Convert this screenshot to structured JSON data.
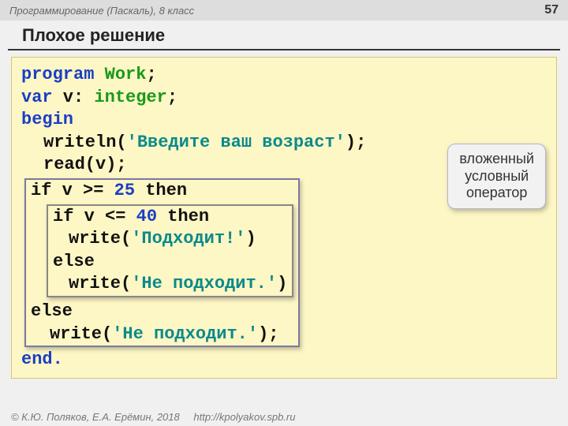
{
  "header": {
    "course": "Программирование (Паскаль), 8 класс",
    "page": "57"
  },
  "title": "Плохое решение",
  "code": {
    "kw_program": "program",
    "prog_name": "Work",
    "semi": ";",
    "kw_var": "var",
    "var_decl": " v: ",
    "kw_integer": "integer",
    "kw_begin": "begin",
    "writeln": "writeln(",
    "str1": "'Введите ваш возраст'",
    "close_paren_semi": ");",
    "read": "read(v);",
    "if1_a": "if v >= ",
    "num25": "25",
    "if1_b": " then",
    "if2_a": "if v <= ",
    "num40": "40",
    "if2_b": " then",
    "write_ok_a": "write(",
    "str_ok": "'Подходит!'",
    "write_ok_b": ")",
    "else1": "else",
    "write_no_a": "write(",
    "str_no": "'Не подходит.'",
    "write_no_b": ")",
    "else2": "else",
    "write_no2_a": "write(",
    "write_no2_b": ");",
    "kw_end": "end."
  },
  "callout": {
    "l1": "вложенный",
    "l2": "условный",
    "l3": "оператор"
  },
  "footer": {
    "copyright": "© К.Ю. Поляков, Е.А. Ерёмин, 2018",
    "url": "http://kpolyakov.spb.ru"
  }
}
